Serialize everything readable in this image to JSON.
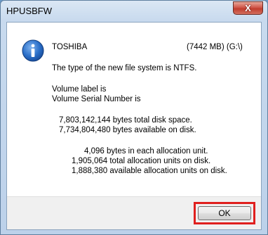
{
  "window": {
    "title": "HPUSBFW",
    "close_label": "X"
  },
  "dialog": {
    "icon": "info-icon",
    "device_name": "TOSHIBA",
    "device_info": "(7442 MB) (G:\\)",
    "filesystem_line": "The type of the new file system is NTFS.",
    "volume_label_line": "Volume label is",
    "volume_serial_line": "Volume Serial Number is",
    "total_space_line": "7,803,142,144 bytes total disk space.",
    "available_space_line": "7,734,804,480 bytes available on disk.",
    "alloc_unit_line": "4,096 bytes in each allocation unit.",
    "total_units_line": "1,905,064 total allocation units on disk.",
    "available_units_line": "1,888,380 available allocation units on disk."
  },
  "footer": {
    "ok_label": "OK"
  },
  "colors": {
    "highlight": "#e0201e",
    "info_icon": "#1f5fb4"
  }
}
